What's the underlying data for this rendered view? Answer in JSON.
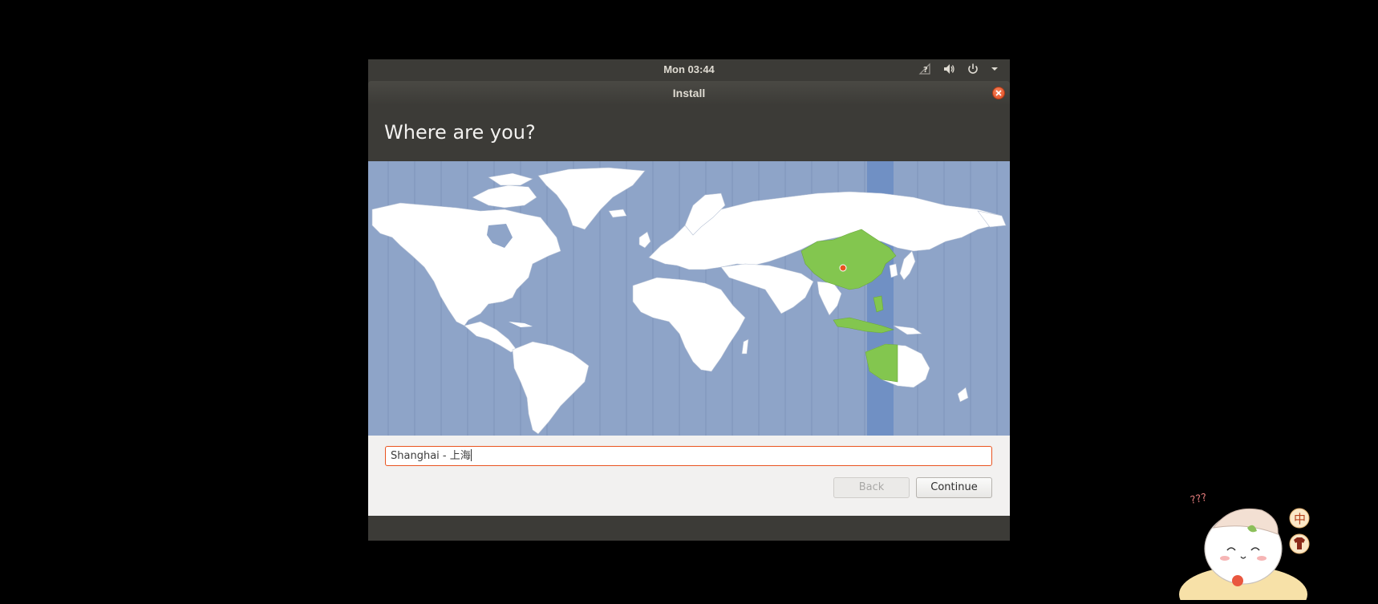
{
  "topbar": {
    "clock": "Mon 03:44",
    "icons": [
      "network-question-icon",
      "volume-icon",
      "power-icon",
      "dropdown-arrow-icon"
    ]
  },
  "window": {
    "title": "Install",
    "heading": "Where are you?"
  },
  "location": {
    "value": "Shanghai - 上海",
    "selected_timezone": "Asia/Shanghai (UTC+8)"
  },
  "buttons": {
    "back": "Back",
    "continue": "Continue"
  },
  "overlay": {
    "question_marks": "???",
    "badge_top": "中",
    "badge_bottom_icon": "shirt-icon"
  },
  "colors": {
    "accent": "#e95420",
    "map_ocean": "#8ea4c8",
    "selected_zone": "#7090c4",
    "selected_country": "#83c64f",
    "land": "#ffffff"
  }
}
